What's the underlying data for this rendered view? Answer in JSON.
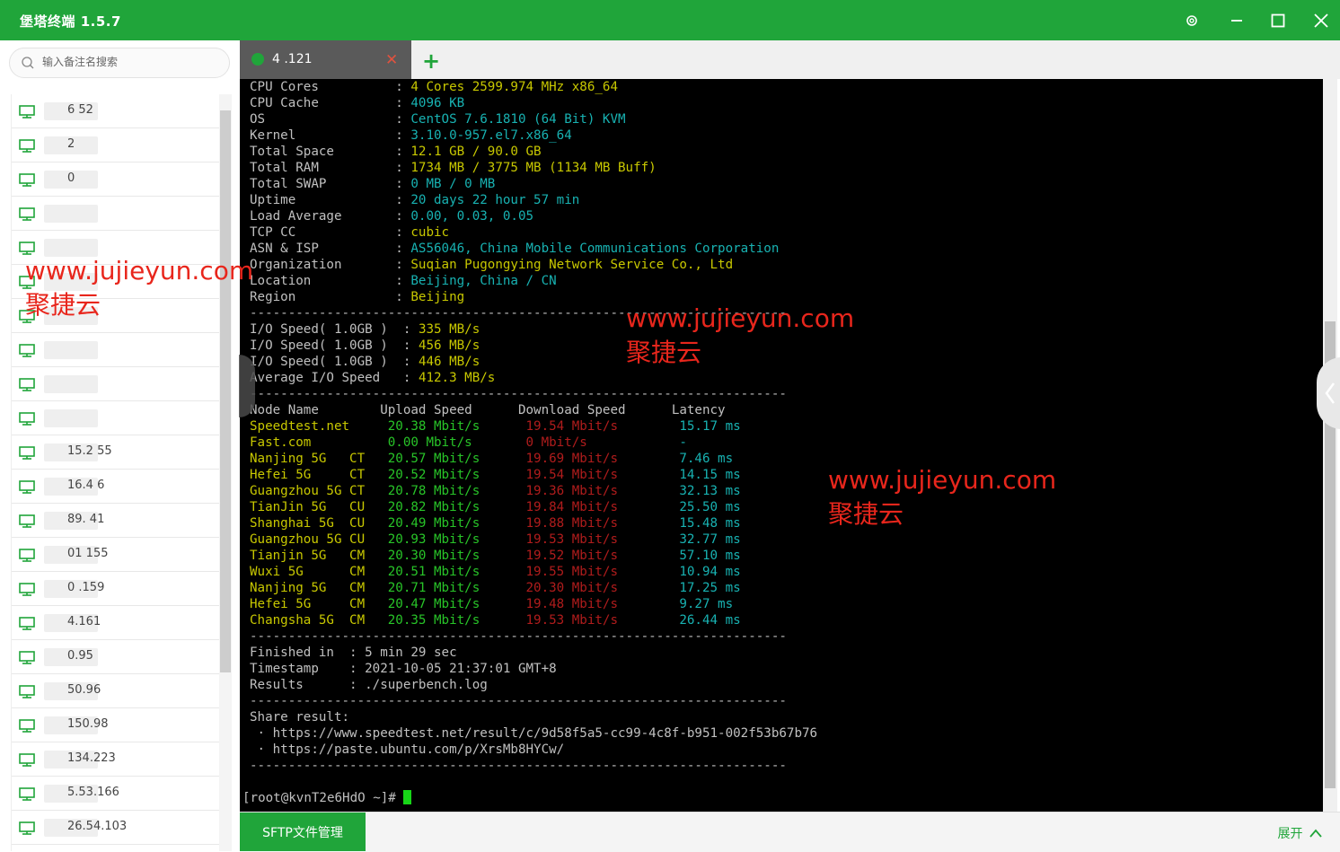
{
  "app": {
    "title": "堡塔终端 1.5.7"
  },
  "sidebar": {
    "search_placeholder": "输入备注名搜索",
    "hosts": [
      {
        "ip": "6    52"
      },
      {
        "ip": "  2"
      },
      {
        "ip": "   0"
      },
      {
        "ip": ""
      },
      {
        "ip": ""
      },
      {
        "ip": ""
      },
      {
        "ip": ""
      },
      {
        "ip": ""
      },
      {
        "ip": ""
      },
      {
        "ip": ""
      },
      {
        "ip": "15.2    55"
      },
      {
        "ip": "16.4    6"
      },
      {
        "ip": "89.     41"
      },
      {
        "ip": "01      155"
      },
      {
        "ip": "0      .159"
      },
      {
        "ip": "      4.161"
      },
      {
        "ip": "     0.95"
      },
      {
        "ip": "50.96"
      },
      {
        "ip": "150.98"
      },
      {
        "ip": "134.223"
      },
      {
        "ip": "5.53.166"
      },
      {
        "ip": "26.54.103"
      }
    ]
  },
  "tab": {
    "label": "4          .121"
  },
  "terminal": {
    "sysinfo": [
      {
        "label": "CPU Cores          ",
        "value": "4 Cores 2599.974 MHz x86_64",
        "color": "y"
      },
      {
        "label": "CPU Cache          ",
        "value": "4096 KB",
        "color": "c"
      },
      {
        "label": "OS                 ",
        "value": "CentOS 7.6.1810 (64 Bit) KVM",
        "color": "c"
      },
      {
        "label": "Kernel             ",
        "value": "3.10.0-957.el7.x86_64",
        "color": "c"
      },
      {
        "label": "Total Space        ",
        "value": "12.1 GB / 90.0 GB",
        "color": "y"
      },
      {
        "label": "Total RAM          ",
        "value": "1734 MB / 3775 MB (1134 MB Buff)",
        "color": "y"
      },
      {
        "label": "Total SWAP         ",
        "value": "0 MB / 0 MB",
        "color": "c"
      },
      {
        "label": "Uptime             ",
        "value": "20 days 22 hour 57 min",
        "color": "c"
      },
      {
        "label": "Load Average       ",
        "value": "0.00, 0.03, 0.05",
        "color": "c"
      },
      {
        "label": "TCP CC             ",
        "value": "cubic",
        "color": "y"
      },
      {
        "label": "ASN & ISP          ",
        "value": "AS56046, China Mobile Communications Corporation",
        "color": "c"
      },
      {
        "label": "Organization       ",
        "value": "Suqian Pugongying Network Service Co., Ltd",
        "color": "y"
      },
      {
        "label": "Location           ",
        "value": "Beijing, China / CN",
        "color": "c"
      },
      {
        "label": "Region             ",
        "value": "Beijing",
        "color": "y"
      }
    ],
    "io": [
      {
        "label": "I/O Speed( 1.0GB )  ",
        "value": "335 MB/s"
      },
      {
        "label": "I/O Speed( 1.0GB )  ",
        "value": "456 MB/s"
      },
      {
        "label": "I/O Speed( 1.0GB )  ",
        "value": "446 MB/s"
      },
      {
        "label": "Average I/O Speed   ",
        "value": "412.3 MB/s"
      }
    ],
    "speed_headers": [
      "Node Name",
      "Upload Speed",
      "Download Speed",
      "Latency"
    ],
    "speed_rows": [
      {
        "node": "Speedtest.net     ",
        "up": "20.38 Mbit/s",
        "down": "19.54 Mbit/s",
        "lat": "15.17 ms"
      },
      {
        "node": "Fast.com          ",
        "up": "0.00 Mbit/s",
        "down": "0 Mbit/s",
        "lat": "-"
      },
      {
        "node": "Nanjing 5G   CT   ",
        "up": "20.57 Mbit/s",
        "down": "19.69 Mbit/s",
        "lat": "7.46 ms"
      },
      {
        "node": "Hefei 5G     CT   ",
        "up": "20.52 Mbit/s",
        "down": "19.54 Mbit/s",
        "lat": "14.15 ms"
      },
      {
        "node": "Guangzhou 5G CT   ",
        "up": "20.78 Mbit/s",
        "down": "19.36 Mbit/s",
        "lat": "32.13 ms"
      },
      {
        "node": "TianJin 5G   CU   ",
        "up": "20.82 Mbit/s",
        "down": "19.84 Mbit/s",
        "lat": "25.50 ms"
      },
      {
        "node": "Shanghai 5G  CU   ",
        "up": "20.49 Mbit/s",
        "down": "19.88 Mbit/s",
        "lat": "15.48 ms"
      },
      {
        "node": "Guangzhou 5G CU   ",
        "up": "20.93 Mbit/s",
        "down": "19.53 Mbit/s",
        "lat": "32.77 ms"
      },
      {
        "node": "Tianjin 5G   CM   ",
        "up": "20.30 Mbit/s",
        "down": "19.52 Mbit/s",
        "lat": "57.10 ms"
      },
      {
        "node": "Wuxi 5G      CM   ",
        "up": "20.51 Mbit/s",
        "down": "19.55 Mbit/s",
        "lat": "10.94 ms"
      },
      {
        "node": "Nanjing 5G   CM   ",
        "up": "20.71 Mbit/s",
        "down": "20.30 Mbit/s",
        "lat": "17.25 ms"
      },
      {
        "node": "Hefei 5G     CM   ",
        "up": "20.47 Mbit/s",
        "down": "19.48 Mbit/s",
        "lat": "9.27 ms"
      },
      {
        "node": "Changsha 5G  CM   ",
        "up": "20.35 Mbit/s",
        "down": "19.53 Mbit/s",
        "lat": "26.44 ms"
      }
    ],
    "finish": [
      {
        "label": "Finished in  ",
        "value": "5 min 29 sec"
      },
      {
        "label": "Timestamp    ",
        "value": "2021-10-05 21:37:01 GMT+8"
      },
      {
        "label": "Results      ",
        "value": "./superbench.log"
      }
    ],
    "share_title": "Share result:",
    "share_links": [
      " · https://www.speedtest.net/result/c/9d58f5a5-cc99-4c8f-b951-002f53b67b76",
      " · https://paste.ubuntu.com/p/XrsMb8HYCw/"
    ],
    "prompt": "[root@kvnT2e6HdO ~]# "
  },
  "watermark": {
    "url": "www.jujieyun.com",
    "name": "聚捷云"
  },
  "bottom": {
    "sftp": "SFTP文件管理",
    "expand": "展开"
  }
}
